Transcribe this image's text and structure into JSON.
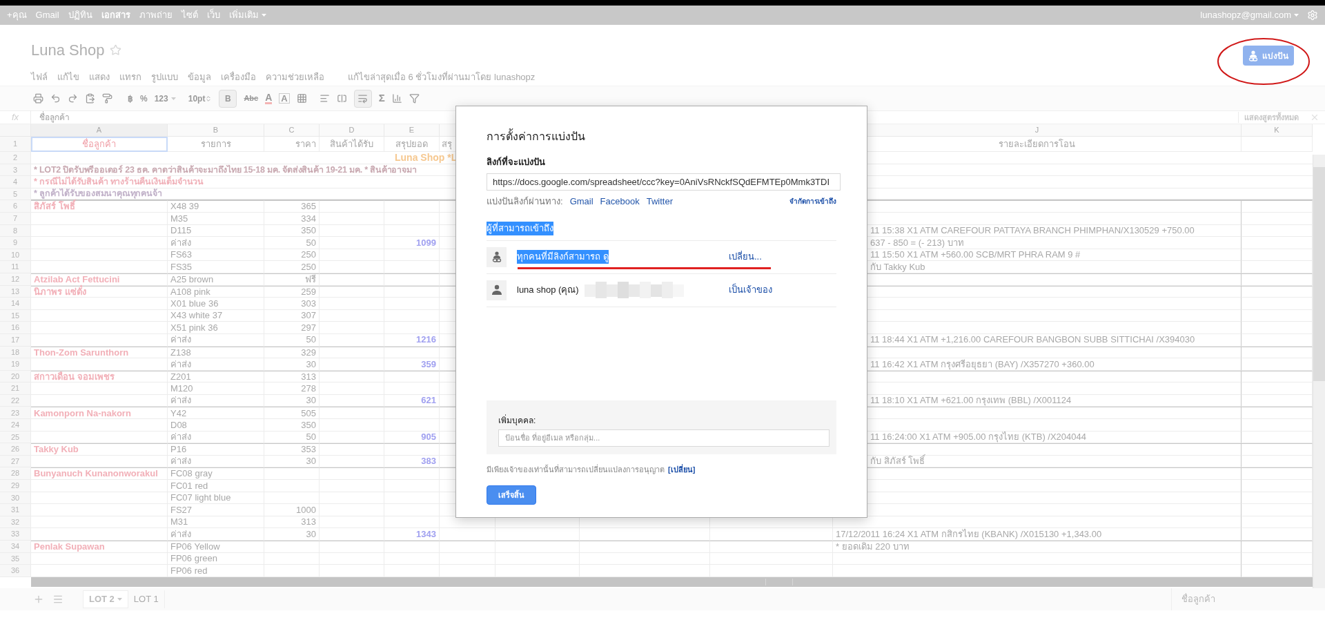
{
  "google_bar": {
    "links": [
      {
        "label": "+คุณ",
        "selected": false
      },
      {
        "label": "Gmail",
        "selected": false
      },
      {
        "label": "ปฏิทิน",
        "selected": false
      },
      {
        "label": "เอกสาร",
        "selected": true
      },
      {
        "label": "ภาพถ่าย",
        "selected": false
      },
      {
        "label": "ไซต์",
        "selected": false
      },
      {
        "label": "เว็บ",
        "selected": false
      },
      {
        "label": "เพิ่มเติม",
        "selected": false
      }
    ],
    "account": "lunashopz@gmail.com"
  },
  "document": {
    "title": "Luna Shop",
    "starred": false,
    "menu": [
      "ไฟล์",
      "แก้ไข",
      "แสดง",
      "แทรก",
      "รูปแบบ",
      "ข้อมูล",
      "เครื่องมือ",
      "ความช่วยเหลือ"
    ],
    "last_edit": "แก้ไขล่าสุดเมื่อ 6 ชั่วโมงที่ผ่านมาโดย lunashopz",
    "share_button": "แบ่งปัน"
  },
  "toolbar": {
    "currency": "฿",
    "percent": "%",
    "number_format": "123",
    "font_size": "10pt",
    "bold": {
      "label": "B",
      "on": true
    },
    "strikethrough": "Abc",
    "text_color": "A",
    "fill_color": "A",
    "wrap": {
      "on": true
    },
    "sum": "Σ"
  },
  "formula_bar": {
    "fx": "fx",
    "value": "ชื่อลูกค้า",
    "show_all": "แสดงสูตรทั้งหมด"
  },
  "column_headers": {
    "A": "A",
    "B": "B",
    "C": "C",
    "D": "D",
    "E": "E",
    "J": "J",
    "K": "K"
  },
  "rows": [
    {
      "n": "1",
      "kind": "header",
      "cells": {
        "A": "ชื่อลูกค้า",
        "B": "รายการ",
        "C": "ราคา",
        "D": "สินค้าได้รับ",
        "E": "สรุปยอด",
        "F": "สรุ",
        "J": "รายละเอียดการโอน"
      }
    },
    {
      "n": "2",
      "kind": "banner",
      "text": "Luna Shop *L"
    },
    {
      "n": "3",
      "kind": "note",
      "text": "* LOT2 ปิดรับพรีออเดอร์ 23 ธค. คาดว่าสินค้าจะมาถึงไทย 15-18 มค. จัดส่งสินค้า 19-21 มค. * สินค้าอาจมา",
      "color": "#c8a8b0"
    },
    {
      "n": "4",
      "kind": "note",
      "text": "* กรณีไม่ได้รับสินค้า ทางร้านคืนเงินเต็มจำนวน",
      "color": "#f0b0b8"
    },
    {
      "n": "5",
      "kind": "note",
      "text": "* ลูกค้าได้รับของสมนาคุณทุกคนจ้า",
      "color": "#c0b0c8"
    },
    {
      "n": "6",
      "kind": "item",
      "cells": {
        "A": "สิภัสร์ โพธิ์",
        "B": "X48 39",
        "C": "365"
      }
    },
    {
      "n": "7",
      "kind": "item",
      "cells": {
        "B": "M35",
        "C": "334"
      }
    },
    {
      "n": "8",
      "kind": "item",
      "cells": {
        "B": "D115",
        "C": "350",
        "J": "11 15:38 X1 ATM CAREFOUR PATTAYA BRANCH PHIMPHAN/X130529 +750.00"
      }
    },
    {
      "n": "9",
      "kind": "item",
      "cells": {
        "B": "ค่าส่ง",
        "C": "50",
        "E": "1099",
        "J": "637 - 850 = (- 213) บาท"
      }
    },
    {
      "n": "10",
      "kind": "item",
      "cells": {
        "B": "FS63",
        "C": "250",
        "J": "11 15:50 X1 ATM +560.00 SCB/MRT PHRA RAM 9 #"
      }
    },
    {
      "n": "11",
      "kind": "item",
      "cells": {
        "B": "FS35",
        "C": "250",
        "J": "กับ Takky Kub"
      }
    },
    {
      "n": "12",
      "kind": "item",
      "cells": {
        "A": "Atzilab Act Fettucini",
        "B": "A25 brown",
        "C": "ฟรี"
      }
    },
    {
      "n": "13",
      "kind": "item",
      "cells": {
        "A": "นิภาพร แซ่ตั๋ง",
        "B": "A108 pink",
        "C": "259"
      }
    },
    {
      "n": "14",
      "kind": "item",
      "cells": {
        "B": "X01 blue 36",
        "C": "303"
      }
    },
    {
      "n": "15",
      "kind": "item",
      "cells": {
        "B": "X43 white 37",
        "C": "307"
      }
    },
    {
      "n": "16",
      "kind": "item",
      "cells": {
        "B": "X51 pink 36",
        "C": "297"
      }
    },
    {
      "n": "17",
      "kind": "item",
      "cells": {
        "B": "ค่าส่ง",
        "C": "50",
        "E": "1216",
        "J": "11 18:44 X1 ATM +1,216.00 CAREFOUR BANGBON SUBB SITTICHAI /X394030"
      }
    },
    {
      "n": "18",
      "kind": "item",
      "cells": {
        "A": "Thon-Zom Sarunthorn",
        "B": "Z138",
        "C": "329"
      }
    },
    {
      "n": "19",
      "kind": "item",
      "cells": {
        "B": "ค่าส่ง",
        "C": "30",
        "E": "359",
        "J": "11 16:42 X1 ATM กรุงศรีอยุธยา (BAY) /X357270 +360.00"
      }
    },
    {
      "n": "20",
      "kind": "item",
      "cells": {
        "A": "สกาวเดือน จอมเพชร",
        "B": "Z201",
        "C": "313"
      }
    },
    {
      "n": "21",
      "kind": "item",
      "cells": {
        "B": "M120",
        "C": "278"
      }
    },
    {
      "n": "22",
      "kind": "item",
      "cells": {
        "B": "ค่าส่ง",
        "C": "30",
        "E": "621",
        "J": "11 18:10 X1 ATM +621.00 กรุงเทพ (BBL) /X001124"
      }
    },
    {
      "n": "23",
      "kind": "item",
      "cells": {
        "A": "Kamonporn Na-nakorn",
        "B": "Y42",
        "C": "505"
      }
    },
    {
      "n": "24",
      "kind": "item",
      "cells": {
        "B": "D08",
        "C": "350"
      }
    },
    {
      "n": "25",
      "kind": "item",
      "cells": {
        "B": "ค่าส่ง",
        "C": "50",
        "E": "905",
        "J": "11 16:24:00 X1 ATM +905.00 กรุงไทย (KTB) /X204044"
      }
    },
    {
      "n": "26",
      "kind": "item",
      "cells": {
        "A": "Takky Kub",
        "B": "P16",
        "C": "353"
      }
    },
    {
      "n": "27",
      "kind": "item",
      "cells": {
        "B": "ค่าส่ง",
        "C": "30",
        "E": "383",
        "J": "กับ สิภัสร์ โพธิ์"
      }
    },
    {
      "n": "28",
      "kind": "item",
      "cells": {
        "A": "Bunyanuch Kunanonworakul",
        "B": "FC08 gray"
      }
    },
    {
      "n": "29",
      "kind": "item",
      "cells": {
        "B": "FC01 red"
      }
    },
    {
      "n": "30",
      "kind": "item",
      "cells": {
        "B": "FC07 light blue"
      }
    },
    {
      "n": "31",
      "kind": "item",
      "cells": {
        "B": "FS27",
        "C": "1000"
      }
    },
    {
      "n": "32",
      "kind": "item",
      "cells": {
        "B": "M31",
        "C": "313"
      }
    },
    {
      "n": "33",
      "kind": "item",
      "cells": {
        "B": "ค่าส่ง",
        "C": "30",
        "E": "1343",
        "J": "17/12/2011 16:24 X1 ATM กสิกรไทย (KBANK) /X015130 +1,343.00"
      }
    },
    {
      "n": "34",
      "kind": "item",
      "cells": {
        "A": "Penlak Supawan",
        "B": "FP06 Yellow",
        "J": "* ยอดเดิม 220 บาท"
      }
    },
    {
      "n": "35",
      "kind": "item",
      "cells": {
        "B": "FP06 green"
      }
    },
    {
      "n": "36",
      "kind": "item",
      "cells": {
        "B": "FP06 red"
      }
    }
  ],
  "sheet_tabs": [
    {
      "label": "LOT 2",
      "selected": true
    },
    {
      "label": "LOT 1",
      "selected": false
    }
  ],
  "active_cell_value": "ชื่อลูกค้า",
  "dialog": {
    "title": "การตั้งค่าการแบ่งปัน",
    "link_label": "ลิงก์ที่จะแบ่งปัน",
    "link_value": "https://docs.google.com/spreadsheet/ccc?key=0AniVsRNckfSQdEFMTEp0Mmk3TDI",
    "share_via_label": "แบ่งปันลิงก์ผ่านทาง:",
    "share_via": [
      "Gmail",
      "Facebook",
      "Twitter"
    ],
    "restrict_link": "จำกัดการเข้าถึง",
    "access_heading": "ผู้ที่สามารถเข้าถึง",
    "access_heading_highlighted": true,
    "access": [
      {
        "kind": "link",
        "label": "ทุกคนที่มีลิงก์สามารถ ดู",
        "action": "เปลี่ยน...",
        "highlighted": true
      },
      {
        "kind": "person",
        "label": "luna shop (คุณ)",
        "action": "เป็นเจ้าของ",
        "highlighted": false
      }
    ],
    "add_people_label": "เพิ่มบุคคล:",
    "add_people_placeholder": "ป้อนชื่อ ที่อยู่อีเมล หรือกลุ่ม...",
    "owner_note": "มีเพียงเจ้าของเท่านั้นที่สามารถเปลี่ยนแปลงการอนุญาต",
    "owner_note_link": "[เปลี่ยน]",
    "done": "เสร็จสิ้น"
  }
}
